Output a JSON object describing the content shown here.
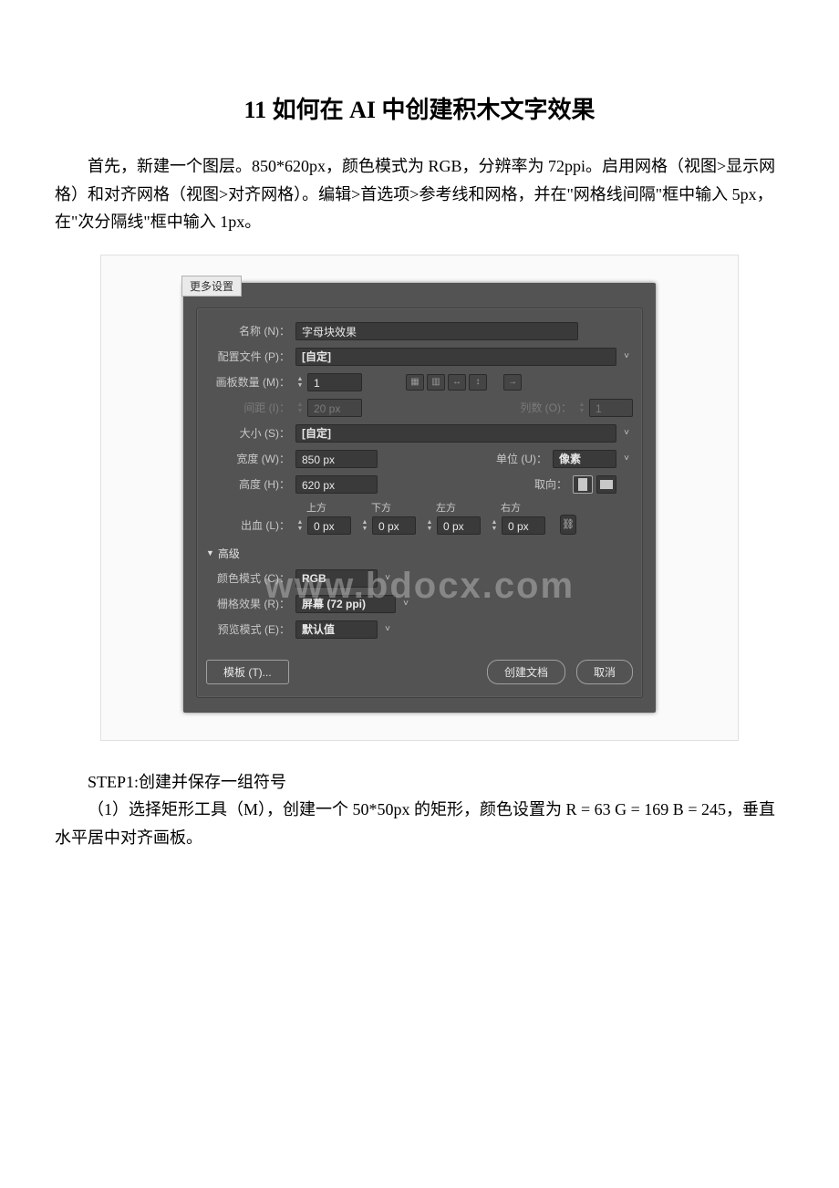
{
  "doc": {
    "title": "11 如何在 AI 中创建积木文字效果",
    "intro": "首先，新建一个图层。850*620px，颜色模式为 RGB，分辨率为 72ppi。启用网格（视图>显示网格）和对齐网格（视图>对齐网格）。编辑>首选项>参考线和网格，并在\"网格线间隔\"框中输入 5px，在\"次分隔线\"框中输入 1px。",
    "step1_heading": "STEP1:创建并保存一组符号",
    "step1_body": "（1）选择矩形工具（M），创建一个 50*50px 的矩形，颜色设置为 R = 63 G = 169 B = 245，垂直水平居中对齐画板。"
  },
  "dialog": {
    "more_settings": "更多设置",
    "name_label": "名称 (N)：",
    "name_value": "字母块效果",
    "profile_label": "配置文件 (P)：",
    "profile_value": "[自定]",
    "artboards_label": "画板数量 (M)：",
    "artboards_value": "1",
    "spacing_label": "间距 (I)：",
    "spacing_value": "20 px",
    "cols_label": "列数 (O)：",
    "cols_value": "1",
    "size_label": "大小 (S)：",
    "size_value": "[自定]",
    "width_label": "宽度 (W)：",
    "width_value": "850 px",
    "units_label": "单位 (U)：",
    "units_value": "像素",
    "height_label": "高度 (H)：",
    "height_value": "620 px",
    "orient_label": "取向：",
    "bleed_label": "出血 (L)：",
    "bleed_top": "上方",
    "bleed_bottom": "下方",
    "bleed_left": "左方",
    "bleed_right": "右方",
    "bleed_value": "0 px",
    "advanced": "高级",
    "color_mode_label": "颜色模式 (C)：",
    "color_mode_value": "RGB",
    "raster_label": "栅格效果 (R)：",
    "raster_value": "屏幕 (72 ppi)",
    "preview_label": "预览模式 (E)：",
    "preview_value": "默认值",
    "templates_btn": "模板 (T)...",
    "create_btn": "创建文档",
    "cancel_btn": "取消"
  },
  "watermark": "www.bdocx.com"
}
